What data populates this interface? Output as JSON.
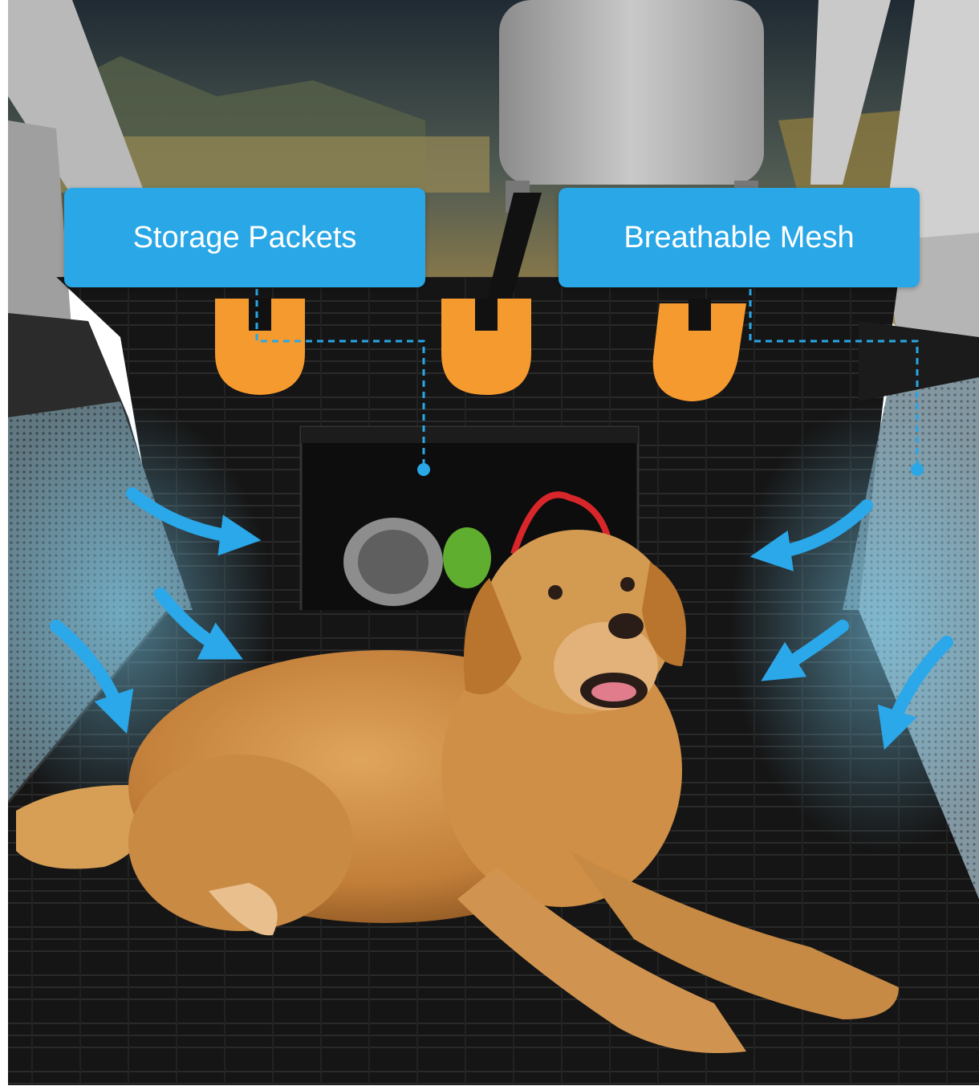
{
  "callouts": {
    "storage_label": "Storage Packets",
    "mesh_label": "Breathable Mesh"
  },
  "colors": {
    "callout_blue": "#29a7e6",
    "arrow_blue": "#2aa8ea",
    "tab_orange": "#f59a2e",
    "cover_black": "#141414",
    "dog_gold": "#c9873f"
  },
  "icons": [
    "airflow-arrow-icon"
  ]
}
